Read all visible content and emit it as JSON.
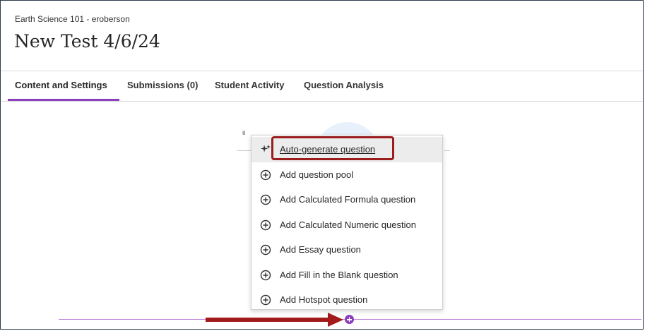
{
  "header": {
    "course": "Earth Science 101 - eroberson",
    "title": "New Test 4/6/24"
  },
  "tabs": [
    {
      "label": "Content and Settings",
      "active": true
    },
    {
      "label": "Submissions (0)",
      "active": false
    },
    {
      "label": "Student Activity",
      "active": false
    },
    {
      "label": "Question Analysis",
      "active": false
    }
  ],
  "behind_menu": {
    "partial_text": "ιι"
  },
  "menu": {
    "items": [
      {
        "label": "Auto-generate question",
        "icon": "sparkle-icon",
        "highlighted": true
      },
      {
        "label": "Add question pool",
        "icon": "add-circle-icon"
      },
      {
        "label": "Add Calculated Formula question",
        "icon": "add-circle-icon"
      },
      {
        "label": "Add Calculated Numeric question",
        "icon": "add-circle-icon"
      },
      {
        "label": "Add Essay question",
        "icon": "add-circle-icon"
      },
      {
        "label": "Add Fill in the Blank question",
        "icon": "add-circle-icon"
      },
      {
        "label": "Add Hotspot question",
        "icon": "add-circle-icon"
      }
    ]
  },
  "colors": {
    "accent": "#8a3fbf",
    "annotation": "#a31a1a",
    "insert_line": "#c07cd8"
  }
}
